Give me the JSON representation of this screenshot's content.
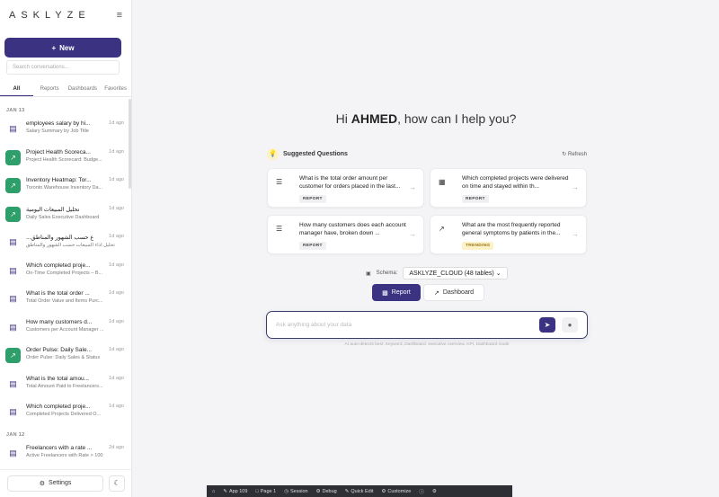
{
  "app": {
    "logo": "ASKLYZE",
    "menu_icon": "hamburger-icon"
  },
  "sidebar": {
    "new_label": "New",
    "search_placeholder": "Search conversations...",
    "tabs": [
      {
        "label": "All",
        "active": true
      },
      {
        "label": "Reports",
        "active": false
      },
      {
        "label": "Dashboards",
        "active": false
      },
      {
        "label": "Favorites",
        "active": false
      }
    ],
    "groups": [
      {
        "date": "JAN 13",
        "items": [
          {
            "title": "employees salary by hi...",
            "sub": "Salary Summary by Job Title",
            "ago": "1d ago",
            "icon": "clipboard-icon"
          },
          {
            "title": "Project Health Scoreca...",
            "sub": "Project Health Scorecard: Budge...",
            "ago": "1d ago",
            "icon": "chart-icon"
          },
          {
            "title": "Inventory Heatmap: Tor...",
            "sub": "Toronto Warehouse Inventory Da...",
            "ago": "1d ago",
            "icon": "chart-icon"
          },
          {
            "title": "تحليل المبيعات اليومية",
            "sub": "Daily Sales Executive Dashboard",
            "ago": "1d ago",
            "icon": "chart-icon"
          },
          {
            "title": "...ع حسب الشهور والمناطق",
            "sub": "تحليل أداء المبيعات حسب الشهور والمناطق",
            "ago": "1d ago",
            "icon": "clipboard-icon"
          },
          {
            "title": "Which completed proje...",
            "sub": "On-Time Completed Projects – B...",
            "ago": "1d ago",
            "icon": "clipboard-icon"
          },
          {
            "title": "What is the total order ...",
            "sub": "Total Order Value and Items Purc...",
            "ago": "1d ago",
            "icon": "clipboard-icon"
          },
          {
            "title": "How many customers d...",
            "sub": "Customers per Account Manager ...",
            "ago": "1d ago",
            "icon": "clipboard-icon"
          },
          {
            "title": "Order Pulse: Daily Sale...",
            "sub": "Order Pulse: Daily Sales & Status",
            "ago": "1d ago",
            "icon": "chart-icon"
          },
          {
            "title": "What is the total amou...",
            "sub": "Total Amount Paid to Freelancers...",
            "ago": "1d ago",
            "icon": "clipboard-icon"
          },
          {
            "title": "Which completed proje...",
            "sub": "Completed Projects Delivered O...",
            "ago": "1d ago",
            "icon": "clipboard-icon"
          }
        ]
      },
      {
        "date": "JAN 12",
        "items": [
          {
            "title": "Freelancers with a rate ...",
            "sub": "Active Freelancers with Rate > 100",
            "ago": "2d ago",
            "icon": "clipboard-icon"
          }
        ]
      }
    ],
    "settings_label": "Settings"
  },
  "main": {
    "greeting_pre": "Hi ",
    "user": "AHMED",
    "greeting_post": ", how can I help you?",
    "suggested_title": "Suggested Questions",
    "refresh_label": "Refresh",
    "cards": [
      {
        "q": "What is the total order amount per customer for orders placed in the last...",
        "badge": "REPORT",
        "icon": "list-icon"
      },
      {
        "q": "Which completed projects were delivered on time and stayed within th...",
        "badge": "REPORT",
        "icon": "calendar-icon"
      },
      {
        "q": "How many customers does each account manager have, broken down ...",
        "badge": "REPORT",
        "icon": "list-icon"
      },
      {
        "q": "What are the most frequently reported general symptoms by patients in the...",
        "badge": "TRENDING",
        "icon": "trend-icon"
      }
    ],
    "schema_label": "Schema:",
    "schema_value": "ASKLYZE_CLOUD (48 tables)",
    "mode_report": "Report",
    "mode_dashboard": "Dashboard",
    "ask_placeholder": "Ask anything about your data",
    "hint": "AI auto-detects best: Keyword, Dashboard, executive overview, KPI, Dashboard mode"
  },
  "toolbar": {
    "items": [
      "App 109",
      "Page 1",
      "Session",
      "Debug",
      "Quick Edit",
      "Customize"
    ]
  }
}
